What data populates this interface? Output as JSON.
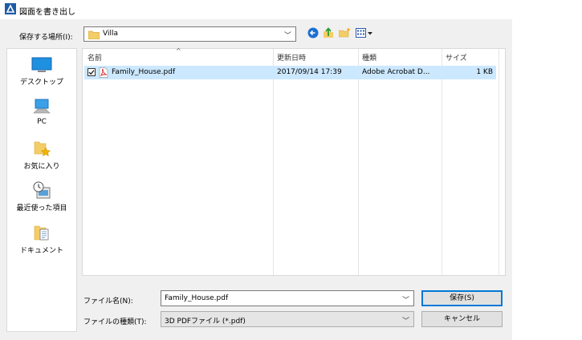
{
  "title": "図面を書き出し",
  "save_in": {
    "label": "保存する場所(I):",
    "value": "Villa"
  },
  "places": [
    {
      "label": "デスクトップ",
      "icon": "desktop-icon"
    },
    {
      "label": "PC",
      "icon": "pc-icon"
    },
    {
      "label": "お気に入り",
      "icon": "favorites-icon"
    },
    {
      "label": "最近使った項目",
      "icon": "recent-items-icon"
    },
    {
      "label": "ドキュメント",
      "icon": "documents-icon"
    }
  ],
  "columns": [
    "名前",
    "更新日時",
    "種類",
    "サイズ"
  ],
  "files": [
    {
      "name": "Family_House.pdf",
      "modified": "2017/09/14 17:39",
      "type": "Adobe Acrobat D...",
      "size": "1 KB",
      "checked": true
    }
  ],
  "filename": {
    "label": "ファイル名(N):",
    "value": "Family_House.pdf"
  },
  "filetype": {
    "label": "ファイルの種類(T):",
    "value": "3D PDFファイル (*.pdf)"
  },
  "buttons": {
    "save": "保存(S)",
    "cancel": "キャンセル"
  },
  "colors": {
    "selection": "#cce8ff",
    "accent": "#0078d7"
  }
}
